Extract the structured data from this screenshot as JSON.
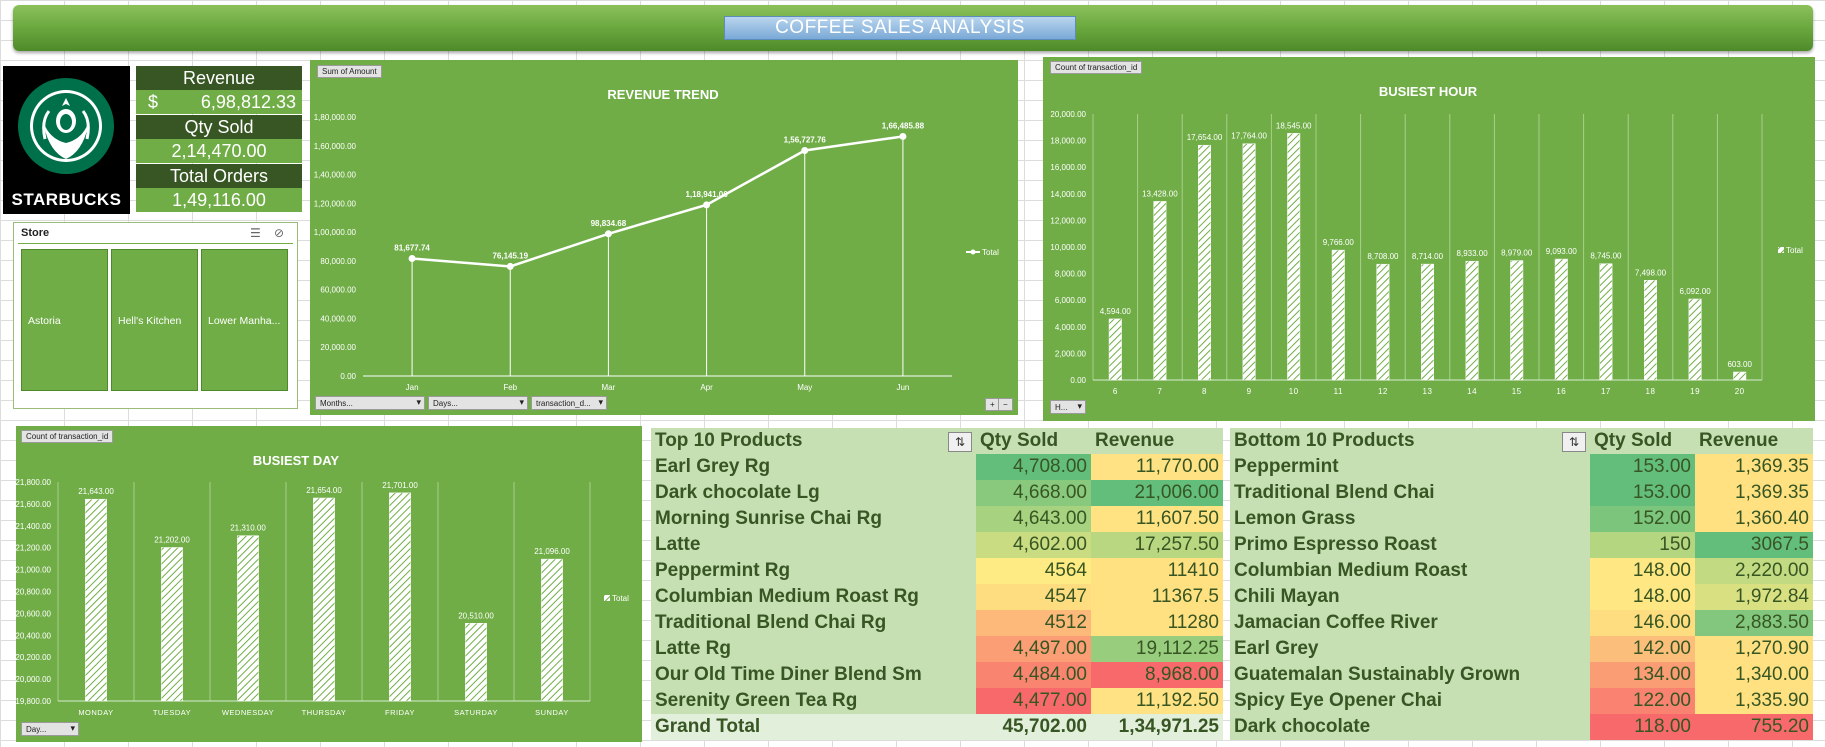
{
  "banner": {
    "title": "COFFEE SALES ANALYSIS"
  },
  "logo": {
    "text": "STARBUCKS"
  },
  "kpis": {
    "revenue_label": "Revenue",
    "revenue_currency": "$",
    "revenue_value": "6,98,812.33",
    "qty_label": "Qty Sold",
    "qty_value": "2,14,470.00",
    "orders_label": "Total Orders",
    "orders_value": "1,49,116.00"
  },
  "slicer": {
    "title": "Store",
    "items": [
      "Astoria",
      "Hell's Kitchen",
      "Lower Manha..."
    ],
    "icons": [
      "multi-select-icon",
      "clear-filter-icon"
    ]
  },
  "revenue_chart": {
    "field_button": "Sum of Amount",
    "filters": [
      "Months...",
      "Days...",
      "transaction_d..."
    ],
    "expand_buttons": [
      "+",
      "−"
    ]
  },
  "hour_chart": {
    "field_button": "Count of transaction_id",
    "filters": [
      "H..."
    ]
  },
  "day_chart": {
    "field_button": "Count of transaction_id",
    "filters": [
      "Day..."
    ]
  },
  "chart_data": [
    {
      "type": "line",
      "title": "REVENUE TREND",
      "categories": [
        "Jan",
        "Feb",
        "Mar",
        "Apr",
        "May",
        "Jun"
      ],
      "series": [
        {
          "name": "Total",
          "values": [
            81677.74,
            76145.19,
            98834.68,
            118941.06,
            156727.76,
            166485.88
          ]
        }
      ],
      "data_labels": [
        "81,677.74",
        "76,145.19",
        "98,834.68",
        "1,18,941.06",
        "1,56,727.76",
        "1,66,485.88"
      ],
      "y_ticks": [
        "0.00",
        "20,000.00",
        "40,000.00",
        "60,000.00",
        "80,000.00",
        "1,00,000.00",
        "1,20,000.00",
        "1,40,000.00",
        "1,60,000.00",
        "1,80,000.00"
      ],
      "ylim": [
        0,
        180000
      ],
      "legend": "right"
    },
    {
      "type": "bar",
      "title": "BUSIEST HOUR",
      "categories": [
        "6",
        "7",
        "8",
        "9",
        "10",
        "11",
        "12",
        "13",
        "14",
        "15",
        "16",
        "17",
        "18",
        "19",
        "20"
      ],
      "series": [
        {
          "name": "Total",
          "values": [
            4594,
            13428,
            17654,
            17764,
            18545,
            9766,
            8708,
            8714,
            8933,
            8979,
            9093,
            8745,
            7498,
            6092,
            603
          ]
        }
      ],
      "data_labels": [
        "4,594.00",
        "13,428.00",
        "17,654.00",
        "17,764.00",
        "18,545.00",
        "9,766.00",
        "8,708.00",
        "8,714.00",
        "8,933.00",
        "8,979.00",
        "9,093.00",
        "8,745.00",
        "7,498.00",
        "6,092.00",
        "603.00"
      ],
      "y_ticks": [
        "0.00",
        "2,000.00",
        "4,000.00",
        "6,000.00",
        "8,000.00",
        "10,000.00",
        "12,000.00",
        "14,000.00",
        "16,000.00",
        "18,000.00",
        "20,000.00"
      ],
      "ylim": [
        0,
        20000
      ],
      "legend": "right"
    },
    {
      "type": "bar",
      "title": "BUSIEST DAY",
      "categories": [
        "MONDAY",
        "TUESDAY",
        "WEDNESDAY",
        "THURSDAY",
        "FRIDAY",
        "SATURDAY",
        "SUNDAY"
      ],
      "series": [
        {
          "name": "Total",
          "values": [
            21643,
            21202,
            21310,
            21654,
            21701,
            20510,
            21096
          ]
        }
      ],
      "data_labels": [
        "21,643.00",
        "21,202.00",
        "21,310.00",
        "21,654.00",
        "21,701.00",
        "20,510.00",
        "21,096.00"
      ],
      "y_ticks": [
        "19,800.00",
        "20,000.00",
        "20,200.00",
        "20,400.00",
        "20,600.00",
        "20,800.00",
        "21,000.00",
        "21,200.00",
        "21,400.00",
        "21,600.00",
        "21,800.00"
      ],
      "ylim": [
        19800,
        21800
      ],
      "legend": "right"
    },
    {
      "type": "table",
      "title": "Top 10 Products",
      "columns": [
        "Top 10 Products",
        "Qty Sold",
        "Revenue"
      ],
      "rows": [
        [
          "Earl Grey Rg",
          "4,708.00",
          "11,770.00"
        ],
        [
          "Dark chocolate Lg",
          "4,668.00",
          "21,006.00"
        ],
        [
          "Morning Sunrise Chai Rg",
          "4,643.00",
          "11,607.50"
        ],
        [
          "Latte",
          "4,602.00",
          "17,257.50"
        ],
        [
          "Peppermint Rg",
          "4564",
          "11410"
        ],
        [
          "Columbian Medium Roast Rg",
          "4547",
          "11367.5"
        ],
        [
          "Traditional Blend Chai Rg",
          "4512",
          "11280"
        ],
        [
          "Latte Rg",
          "4,497.00",
          "19,112.25"
        ],
        [
          "Our Old Time Diner Blend Sm",
          "4,484.00",
          "8,968.00"
        ],
        [
          "Serenity Green Tea Rg",
          "4,477.00",
          "11,192.50"
        ]
      ],
      "total": [
        "Grand Total",
        "45,702.00",
        "1,34,971.25"
      ],
      "qty_colors": [
        "#63be7b",
        "#89c97d",
        "#a7d27f",
        "#c9dc81",
        "#ffeb84",
        "#fedd81",
        "#fcb97a",
        "#fb9d75",
        "#f98570",
        "#f8696b"
      ],
      "rev_colors": [
        "#ffe283",
        "#63be7b",
        "#ffe383",
        "#b9d780",
        "#ffe182",
        "#ffe182",
        "#ffe182",
        "#99cd7e",
        "#f8696b",
        "#ffe283"
      ]
    },
    {
      "type": "table",
      "title": "Bottom 10 Products",
      "columns": [
        "Bottom 10 Products",
        "Qty Sold",
        "Revenue"
      ],
      "rows": [
        [
          "Peppermint",
          "153.00",
          "1,369.35"
        ],
        [
          "Traditional Blend Chai",
          "153.00",
          "1,369.35"
        ],
        [
          "Lemon Grass",
          "152.00",
          "1,360.40"
        ],
        [
          "Primo Espresso Roast",
          "150",
          "3067.5"
        ],
        [
          "Columbian Medium Roast",
          "148.00",
          "2,220.00"
        ],
        [
          "Chili Mayan",
          "148.00",
          "1,972.84"
        ],
        [
          "Jamacian Coffee River",
          "146.00",
          "2,883.50"
        ],
        [
          "Earl Grey",
          "142.00",
          "1,270.90"
        ],
        [
          "Guatemalan Sustainably Grown",
          "134.00",
          "1,340.00"
        ],
        [
          "Spicy Eye Opener Chai",
          "122.00",
          "1,335.90"
        ],
        [
          "Dark chocolate",
          "118.00",
          "755.20"
        ]
      ],
      "qty_colors": [
        "#63be7b",
        "#63be7b",
        "#7cc57c",
        "#b4d680",
        "#ffe784",
        "#ffe784",
        "#fedd81",
        "#fcbf7b",
        "#fa9d75",
        "#f98370",
        "#f8696b"
      ],
      "rev_colors": [
        "#ffe182",
        "#ffe182",
        "#ffe182",
        "#63be7b",
        "#c2da81",
        "#d9e082",
        "#82c77d",
        "#fee082",
        "#ffe182",
        "#ffe182",
        "#f8696b"
      ]
    }
  ]
}
